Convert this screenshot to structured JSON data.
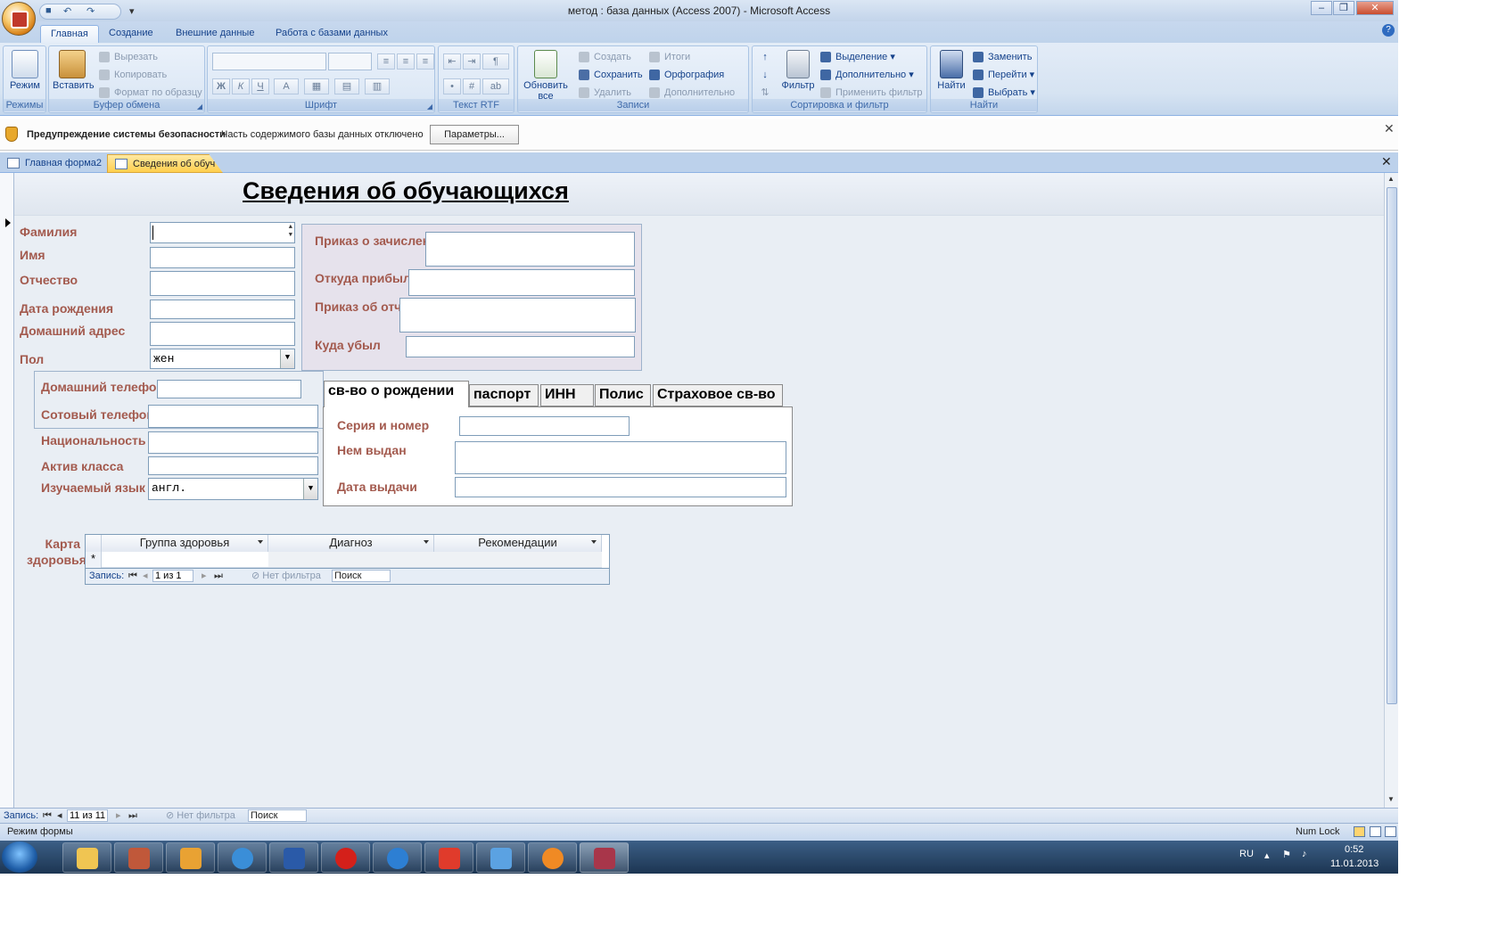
{
  "window": {
    "title": "метод : база данных (Access 2007) - Microsoft Access"
  },
  "ribbon_tabs": [
    "Главная",
    "Создание",
    "Внешние данные",
    "Работа с базами данных"
  ],
  "ribbon": {
    "modes": {
      "label": "Режимы",
      "mode_button": "Режим"
    },
    "clipboard": {
      "label": "Буфер обмена",
      "paste": "Вставить",
      "cut": "Вырезать",
      "copy": "Копировать",
      "format_painter": "Формат по образцу"
    },
    "font": {
      "label": "Шрифт",
      "bold": "Ж",
      "italic": "К",
      "underline": "Ч",
      "font_color": "А"
    },
    "rtf": {
      "label": "Текст RTF"
    },
    "records": {
      "label": "Записи",
      "refresh": "Обновить все",
      "new": "Создать",
      "save": "Сохранить",
      "delete": "Удалить",
      "totals": "Итоги",
      "spelling": "Орфография",
      "more": "Дополнительно"
    },
    "sort": {
      "label": "Сортировка и фильтр",
      "filter": "Фильтр",
      "selection": "Выделение",
      "advanced": "Дополнительно",
      "apply_filter": "Применить фильтр"
    },
    "find": {
      "label": "Найти",
      "find": "Найти",
      "replace": "Заменить",
      "goto": "Перейти",
      "select": "Выбрать"
    }
  },
  "security": {
    "title": "Предупреждение системы безопасности",
    "text": "Часть содержимого базы данных отключено",
    "button": "Параметры..."
  },
  "doc_tabs": [
    "Главная форма2",
    "Сведения об обуч"
  ],
  "form": {
    "title": "Сведения об обучающихся",
    "labels": {
      "surname": "Фамилия",
      "name": "Имя",
      "patronymic": "Отчество",
      "birthdate": "Дата рождения",
      "address": "Домашний адрес",
      "gender": "Пол",
      "order_in": "Приказ о зачислении",
      "from": "Откуда прибыл",
      "order_out": "Приказ об отчислении",
      "to": "Куда убыл",
      "home_phone": "Домашний телефон",
      "mobile": "Сотовый телефон",
      "nationality": "Национальность",
      "class_activity": "Актив класса",
      "language": "Изучаемый язык",
      "health_card": "Карта здоровья"
    },
    "values": {
      "gender": "жен",
      "language": "англ."
    },
    "tabs": [
      "св-во о рождении",
      "паспорт",
      "ИНН",
      "Полис",
      "Страховое св-во"
    ],
    "tab_labels": {
      "series": "Серия и номер",
      "issued_by": "Нем выдан",
      "issue_date": "Дата выдачи"
    },
    "subform": {
      "columns": [
        "Группа здоровья",
        "Диагноз",
        "Рекомендации"
      ],
      "new_row_marker": "*",
      "nav_label": "Запись:",
      "nav_count": "1 из 1",
      "no_filter": "Нет фильтра",
      "search": "Поиск"
    }
  },
  "record_nav": {
    "label": "Запись:",
    "count": "11 из 11",
    "no_filter": "Нет фильтра",
    "search": "Поиск"
  },
  "status": {
    "mode": "Режим формы",
    "numlock": "Num Lock"
  },
  "taskbar": {
    "lang": "RU",
    "time": "0:52",
    "date": "11.01.2013"
  }
}
